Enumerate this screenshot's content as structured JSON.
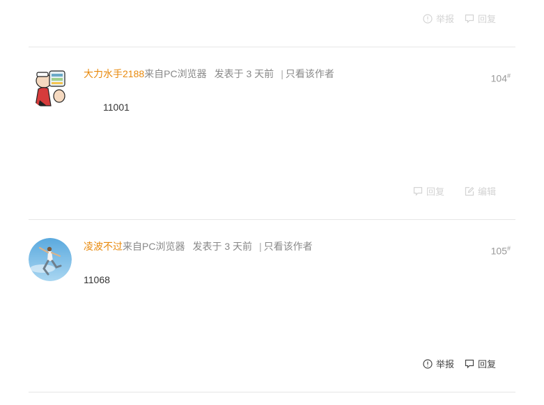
{
  "top_actions": {
    "report_label": "举报",
    "reply_label": "回复"
  },
  "posts": [
    {
      "username": "大力水手2188",
      "source": "来自PC浏览器",
      "posted": "发表于 3 天前",
      "separator": "|",
      "only_author": "只看该作者",
      "floor": "104",
      "floor_mark": "#",
      "content": "11001",
      "actions": {
        "reply_label": "回复",
        "edit_label": "编辑"
      }
    },
    {
      "username": "凌波不过",
      "source": "来自PC浏览器",
      "posted": "发表于 3 天前",
      "separator": "|",
      "only_author": "只看该作者",
      "floor": "105",
      "floor_mark": "#",
      "content": "11068",
      "actions": {
        "report_label": "举报",
        "reply_label": "回复"
      }
    }
  ],
  "colors": {
    "username": "#e8890c",
    "meta_text": "#888888",
    "divider": "#e6e6e6",
    "faded_action": "#d3d3d3",
    "active_action": "#444444"
  },
  "icons": [
    "report-icon",
    "reply-icon",
    "edit-icon"
  ]
}
